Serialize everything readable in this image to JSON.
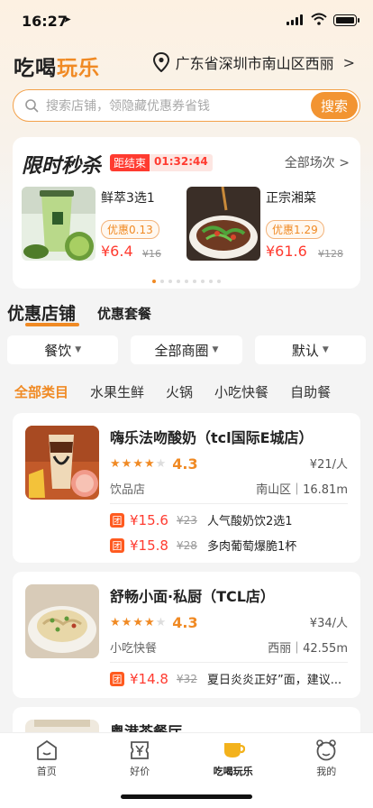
{
  "status_bar": {
    "time": "16:27"
  },
  "header": {
    "logo_part1": "吃喝",
    "logo_part2": "玩乐",
    "location": "广东省深圳市南山区西丽",
    "location_chevron": ">"
  },
  "search": {
    "placeholder": "搜索店铺，领隐藏优惠券省钱",
    "button": "搜索"
  },
  "flash_sale": {
    "title": "限时秒杀",
    "ends_label": "距结束",
    "countdown": "01:32:44",
    "all_sessions": "全部场次 >",
    "deals": [
      {
        "name": "鲜萃3选1",
        "coupon": "优惠0.13",
        "price": "¥6.4",
        "original": "¥16"
      },
      {
        "name": "正宗湘菜",
        "coupon": "优惠1.29",
        "price": "¥61.6",
        "original": "¥128"
      }
    ]
  },
  "section_tabs": {
    "active": "优惠店铺",
    "other": "优惠套餐"
  },
  "filters": [
    "餐饮",
    "全部商圈",
    "默认"
  ],
  "categories": [
    "全部类目",
    "水果生鲜",
    "火锅",
    "小吃快餐",
    "自助餐"
  ],
  "stores": [
    {
      "name": "嗨乐法吻酸奶（tcl国际E城店）",
      "rating": "4.3",
      "avg_price": "¥21/人",
      "category": "饮品店",
      "location_distance": "南山区｜16.81m",
      "deals": [
        {
          "tag": "团",
          "price": "¥15.6",
          "original": "¥23",
          "name": "人气酸奶饮2选1"
        },
        {
          "tag": "团",
          "price": "¥15.8",
          "original": "¥28",
          "name": "多肉葡萄爆脆1杯"
        }
      ]
    },
    {
      "name": "舒畅小面·私厨（TCL店）",
      "rating": "4.3",
      "avg_price": "¥34/人",
      "category": "小吃快餐",
      "location_distance": "西丽｜42.55m",
      "deals": [
        {
          "tag": "团",
          "price": "¥14.8",
          "original": "¥32",
          "name": "夏日炎炎正好”面，建议..."
        }
      ]
    },
    {
      "name": "粤港茶餐厅"
    }
  ],
  "bottom_nav": [
    "首页",
    "好价",
    "吃喝玩乐",
    "我的"
  ],
  "colors": {
    "accent": "#f08a24",
    "price_red": "#ff3b30"
  }
}
